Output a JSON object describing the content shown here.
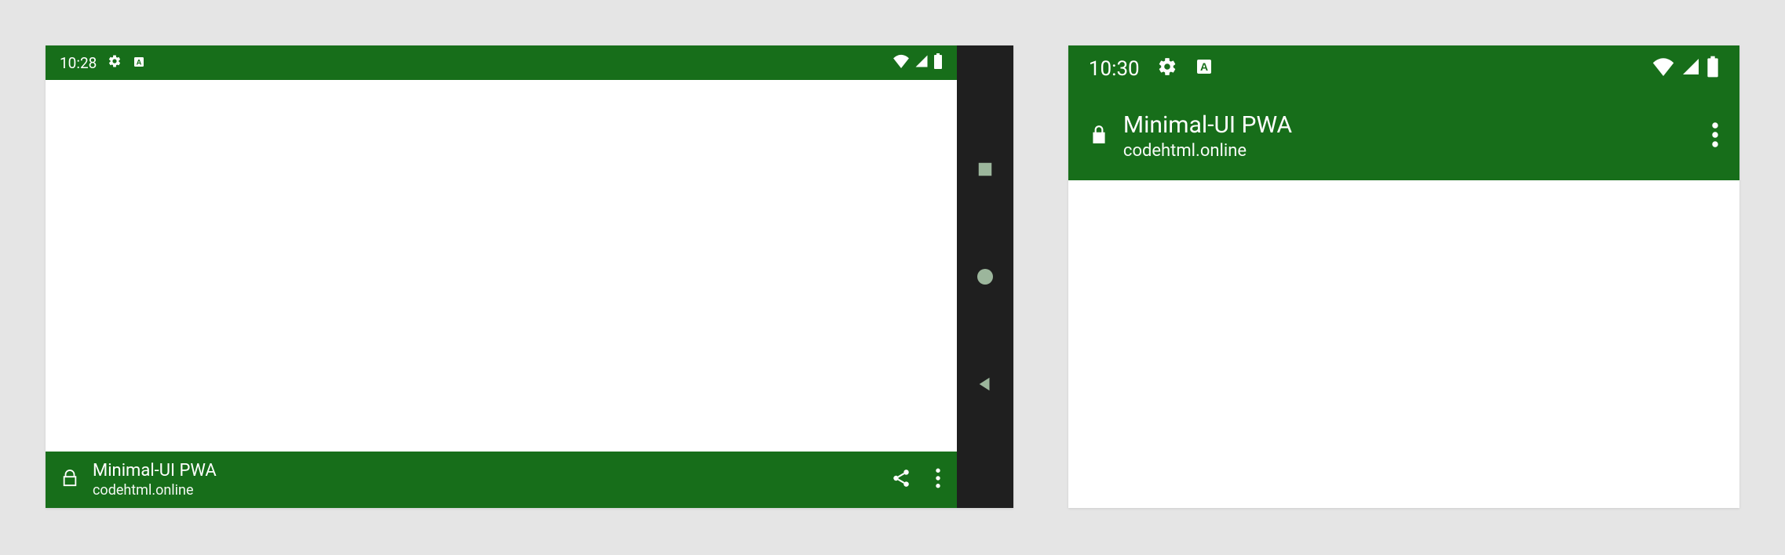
{
  "left": {
    "status": {
      "time": "10:28"
    },
    "app": {
      "title": "Minimal-UI PWA",
      "domain": "codehtml.online"
    }
  },
  "right": {
    "status": {
      "time": "10:30"
    },
    "app": {
      "title": "Minimal-UI PWA",
      "domain": "codehtml.online"
    }
  }
}
